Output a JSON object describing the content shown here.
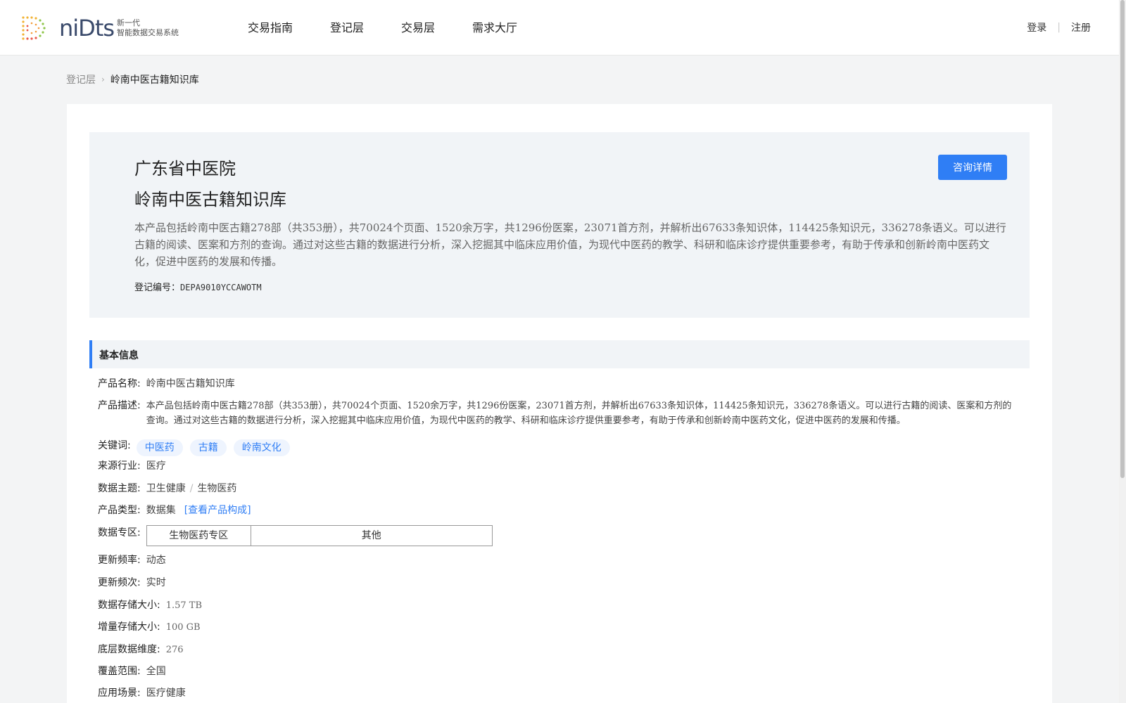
{
  "header": {
    "logo_word": "niDts",
    "logo_sub_1": "新一代",
    "logo_sub_2": "智能数据交易系统",
    "nav": [
      "交易指南",
      "登记层",
      "交易层",
      "需求大厅"
    ],
    "login": "登录",
    "register": "注册"
  },
  "breadcrumb": {
    "parent": "登记层",
    "current": "岭南中医古籍知识库"
  },
  "hero": {
    "org": "广东省中医院",
    "title": "岭南中医古籍知识库",
    "desc": "本产品包括岭南中医古籍278部（共353册），共70024个页面、1520余万字，共1296份医案，23071首方剂，并解析出67633条知识体，114425条知识元，336278条语义。可以进行古籍的阅读、医案和方剂的查询。通过对这些古籍的数据进行分析，深入挖掘其中临床应用价值，为现代中医药的教学、科研和临床诊疗提供重要参考，有助于传承和创新岭南中医药文化，促进中医药的发展和传播。",
    "reg_label": "登记编号：",
    "reg_code": "DEPA9010YCCAWOTM",
    "consult_button": "咨询详情"
  },
  "section": {
    "title": "基本信息"
  },
  "info": {
    "name_label": "产品名称:",
    "name": "岭南中医古籍知识库",
    "desc_label": "产品描述:",
    "desc": "本产品包括岭南中医古籍278部（共353册），共70024个页面、1520余万字，共1296份医案，23071首方剂，并解析出67633条知识体，114425条知识元，336278条语义。可以进行古籍的阅读、医案和方剂的查询。通过对这些古籍的数据进行分析，深入挖掘其中临床应用价值，为现代中医药的教学、科研和临床诊疗提供重要参考，有助于传承和创新岭南中医药文化，促进中医药的发展和传播。",
    "keywords_label": "关键词:",
    "keywords": [
      "中医药",
      "古籍",
      "岭南文化"
    ],
    "industry_label": "来源行业:",
    "industry": "医疗",
    "theme_label": "数据主题:",
    "theme_1": "卫生健康",
    "theme_sep": "/",
    "theme_2": "生物医药",
    "type_label": "产品类型:",
    "type": "数据集",
    "type_link": "[查看产品构成]",
    "zone_label": "数据专区:",
    "zones": [
      "生物医药专区",
      "其他"
    ],
    "freq_label": "更新频率:",
    "freq": "动态",
    "times_label": "更新频次:",
    "times": "实时",
    "storage_label": "数据存储大小:",
    "storage": "1.57 TB",
    "incr_label": "增量存储大小:",
    "incr": "100 GB",
    "dim_label": "底层数据维度:",
    "dim": "276",
    "coverage_label": "覆盖范围:",
    "coverage": "全国",
    "scene_label": "应用场景:",
    "scene": "医疗健康"
  },
  "colors": {
    "accent": "#2f7ef5",
    "hero_bg": "#f1f4f7",
    "page_bg": "#f3f4f5"
  }
}
